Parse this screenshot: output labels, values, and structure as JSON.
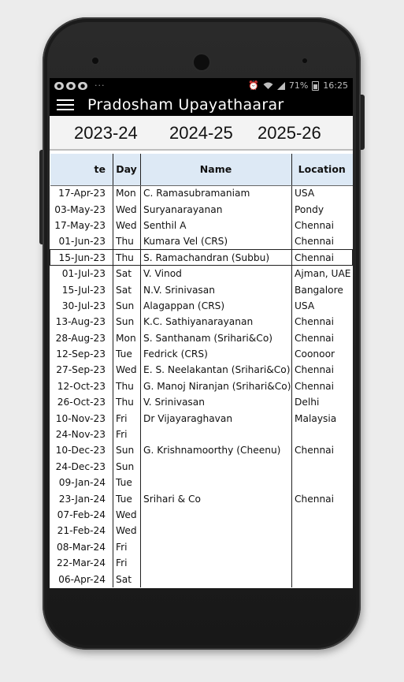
{
  "status": {
    "battery": "71%",
    "time": "16:25",
    "dots": "···"
  },
  "app": {
    "title": "Pradosham Upayathaarar"
  },
  "years": [
    "2023-24",
    "2024-25",
    "2025-26"
  ],
  "table": {
    "headers": [
      "te",
      "Day",
      "Name",
      "Location"
    ],
    "rows": [
      [
        "17-Apr-23",
        "Mon",
        "C. Ramasubramaniam",
        "USA"
      ],
      [
        "03-May-23",
        "Wed",
        "Suryanarayanan",
        "Pondy"
      ],
      [
        "17-May-23",
        "Wed",
        "Senthil A",
        "Chennai"
      ],
      [
        "01-Jun-23",
        "Thu",
        "Kumara Vel (CRS)",
        "Chennai"
      ],
      [
        "15-Jun-23",
        "Thu",
        "S. Ramachandran (Subbu)",
        "Chennai"
      ],
      [
        "01-Jul-23",
        "Sat",
        "V. Vinod",
        "Ajman, UAE"
      ],
      [
        "15-Jul-23",
        "Sat",
        "N.V. Srinivasan",
        "Bangalore"
      ],
      [
        "30-Jul-23",
        "Sun",
        "Alagappan (CRS)",
        "USA"
      ],
      [
        "13-Aug-23",
        "Sun",
        "K.C. Sathiyanarayanan",
        "Chennai"
      ],
      [
        "28-Aug-23",
        "Mon",
        "S. Santhanam (Srihari&Co)",
        "Chennai"
      ],
      [
        "12-Sep-23",
        "Tue",
        "Fedrick  (CRS)",
        "Coonoor"
      ],
      [
        "27-Sep-23",
        "Wed",
        "E. S. Neelakantan (Srihari&Co)",
        "Chennai"
      ],
      [
        "12-Oct-23",
        "Thu",
        "G. Manoj Niranjan (Srihari&Co)",
        "Chennai"
      ],
      [
        "26-Oct-23",
        "Thu",
        "V. Srinivasan",
        "Delhi"
      ],
      [
        "10-Nov-23",
        "Fri",
        "Dr Vijayaraghavan",
        "Malaysia"
      ],
      [
        "24-Nov-23",
        "Fri",
        "",
        ""
      ],
      [
        "10-Dec-23",
        "Sun",
        "G. Krishnamoorthy (Cheenu)",
        "Chennai"
      ],
      [
        "24-Dec-23",
        "Sun",
        "",
        ""
      ],
      [
        "09-Jan-24",
        "Tue",
        "",
        ""
      ],
      [
        "23-Jan-24",
        "Tue",
        "Srihari & Co",
        "Chennai"
      ],
      [
        "07-Feb-24",
        "Wed",
        "",
        ""
      ],
      [
        "21-Feb-24",
        "Wed",
        "",
        ""
      ],
      [
        "08-Mar-24",
        "Fri",
        "",
        ""
      ],
      [
        "22-Mar-24",
        "Fri",
        "",
        ""
      ],
      [
        "06-Apr-24",
        "Sat",
        "",
        ""
      ]
    ],
    "selected_row": 4
  }
}
